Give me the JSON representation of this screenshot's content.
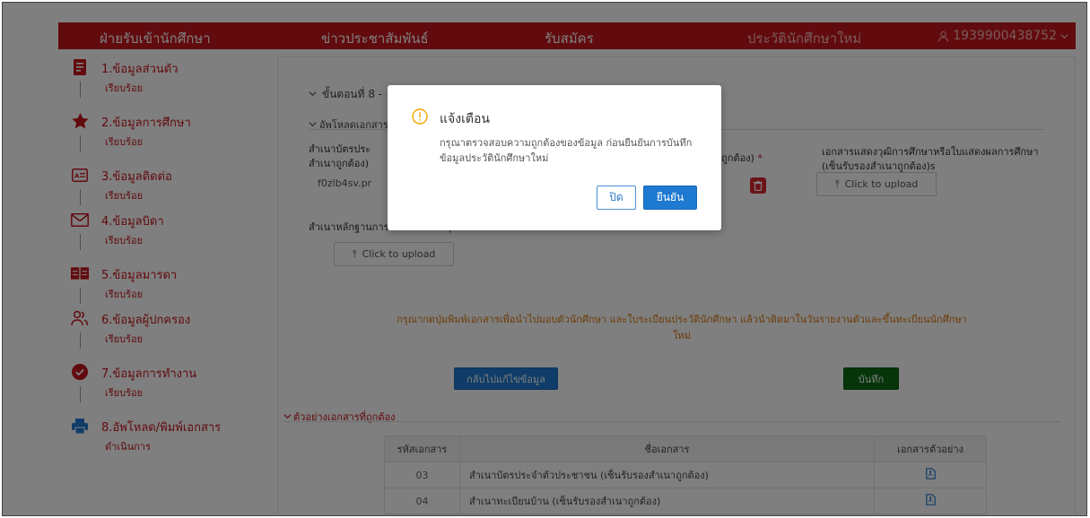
{
  "nav": {
    "admissions": "ฝ่ายรับเข้านักศึกษา",
    "news": "ข่าวประชาสัมพันธ์",
    "apply": "รับสมัคร",
    "history": "ประวัตินักศึกษาใหม่",
    "user_id": "1939900438752"
  },
  "sidebar": {
    "items": [
      {
        "label": "1.ข้อมูลส่วนตัว",
        "status": "เรียบร้อย"
      },
      {
        "label": "2.ข้อมูลการศึกษา",
        "status": "เรียบร้อย"
      },
      {
        "label": "3.ข้อมูลติดต่อ",
        "status": "เรียบร้อย"
      },
      {
        "label": "4.ข้อมูลบิดา",
        "status": "เรียบร้อย"
      },
      {
        "label": "5.ข้อมูลมารดา",
        "status": "เรียบร้อย"
      },
      {
        "label": "6.ข้อมูลผู้ปกครอง",
        "status": "เรียบร้อย"
      },
      {
        "label": "7.ข้อมูลการทำงาน",
        "status": "เรียบร้อย"
      },
      {
        "label": "8.อัพโหลด/พิมพ์เอกสาร",
        "status": "ดำเนินการ"
      }
    ]
  },
  "main": {
    "step_header": "ขั้นตอนที่ 8 -",
    "upload_section": "อัพโหลดเอกสาร",
    "doc1_label_a": "สำเนาบัตรประ",
    "doc1_label_b": "สำเนาถูกต้อง)",
    "doc1_file": "f0zlb4sv.pr",
    "doc2_label_tail": "าถูกต้อง)",
    "doc2_required": "*",
    "doc3_label_a": "เอกสารแสดงวุฒิการศึกษาหรือใบแสดงผลการศึกษา",
    "doc3_label_b": "(เซ็นรับรองสำเนาถูกต้อง)s",
    "doc4_label": "สำเนาหลักฐานการเปลี่ยนชื่อ - สกุล",
    "upload_label": "Click to upload",
    "notice_line1": "กรุณากดปุ่มพิมพ์เอกสารเพื่อนำไปมอบตัวนักศึกษา และใบระเบียนประวัตินักศึกษา แล้วนำติดมาในวันรายงานตัวและขึ้นทะเบียนนักศึกษา",
    "notice_line2": "ใหม่",
    "back_button": "กลับไปแก้ไขข้อมูล",
    "save_button": "บันทึก",
    "examples_section": "ตัวอย่างเอกสารที่ถูกต้อง",
    "table": {
      "headers": [
        "รหัสเอกสาร",
        "ชื่อเอกสาร",
        "เอกสารตัวอย่าง"
      ],
      "rows": [
        {
          "code": "03",
          "name": "สำเนาบัตรประจำตัวประชาชน (เซ็นรับรองสำเนาถูกต้อง)"
        },
        {
          "code": "04",
          "name": "สำเนาทะเบียนบ้าน (เซ็นรับรองสำเนาถูกต้อง)"
        }
      ]
    }
  },
  "modal": {
    "title": "แจ้งเตือน",
    "message": "กรุณาตรวจสอบความถูกต้องของข้อมูล ก่อนยืนยันการบันทึกข้อมูลประวัตินักศึกษาใหม่",
    "cancel": "ปิด",
    "confirm": "ยืนยัน"
  },
  "colors": {
    "brand_red": "#c5161d",
    "primary_blue": "#1e79d1",
    "save_green": "#0d6a14",
    "notice_orange": "#d87a10",
    "warning_yellow": "#f0a800"
  }
}
